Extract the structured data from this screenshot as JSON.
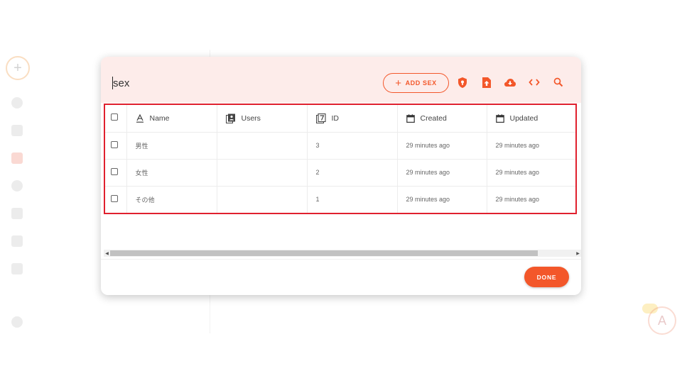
{
  "dialog": {
    "title": "sex",
    "add_button_label": "ADD SEX",
    "done_button_label": "DONE",
    "toolbar_icons": [
      "shield-icon",
      "file-upload-icon",
      "cloud-download-icon",
      "code-icon",
      "search-icon"
    ]
  },
  "table": {
    "headers": {
      "name": "Name",
      "users": "Users",
      "id": "ID",
      "created": "Created",
      "updated": "Updated"
    },
    "rows": [
      {
        "name": "男性",
        "users": "",
        "id": "3",
        "created": "29 minutes ago",
        "updated": "29 minutes ago"
      },
      {
        "name": "女性",
        "users": "",
        "id": "2",
        "created": "29 minutes ago",
        "updated": "29 minutes ago"
      },
      {
        "name": "その他",
        "users": "",
        "id": "1",
        "created": "29 minutes ago",
        "updated": "29 minutes ago"
      }
    ]
  },
  "colors": {
    "accent": "#f3572a",
    "header_bg": "#fdecea",
    "highlight_border": "#e0202e"
  }
}
